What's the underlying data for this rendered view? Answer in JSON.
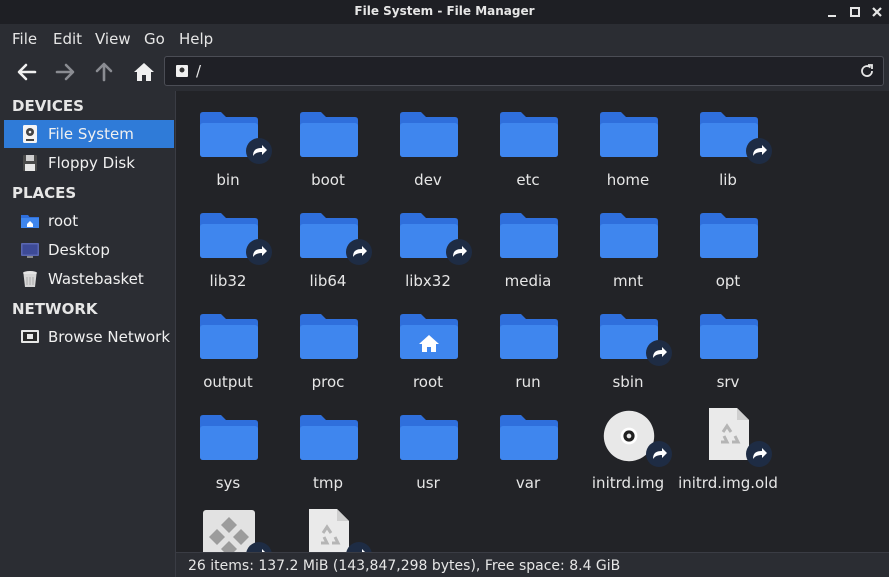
{
  "window": {
    "title": "File System - File Manager"
  },
  "menu": [
    "File",
    "Edit",
    "View",
    "Go",
    "Help"
  ],
  "location": {
    "path": "/"
  },
  "sidebar": {
    "devices_label": "DEVICES",
    "devices": [
      {
        "label": "File System",
        "icon": "drive-icon",
        "active": true
      },
      {
        "label": "Floppy Disk",
        "icon": "floppy-icon",
        "active": false
      }
    ],
    "places_label": "PLACES",
    "places": [
      {
        "label": "root",
        "icon": "home-folder-icon"
      },
      {
        "label": "Desktop",
        "icon": "desktop-icon"
      },
      {
        "label": "Wastebasket",
        "icon": "trash-icon"
      }
    ],
    "network_label": "NETWORK",
    "network": [
      {
        "label": "Browse Network",
        "icon": "network-icon"
      }
    ]
  },
  "files": [
    {
      "name": "bin",
      "type": "folder",
      "link": true
    },
    {
      "name": "boot",
      "type": "folder",
      "link": false
    },
    {
      "name": "dev",
      "type": "folder",
      "link": false
    },
    {
      "name": "etc",
      "type": "folder",
      "link": false
    },
    {
      "name": "home",
      "type": "folder",
      "link": false
    },
    {
      "name": "lib",
      "type": "folder",
      "link": true
    },
    {
      "name": "lib32",
      "type": "folder",
      "link": true
    },
    {
      "name": "lib64",
      "type": "folder",
      "link": true
    },
    {
      "name": "libx32",
      "type": "folder",
      "link": true
    },
    {
      "name": "media",
      "type": "folder",
      "link": false
    },
    {
      "name": "mnt",
      "type": "folder",
      "link": false
    },
    {
      "name": "opt",
      "type": "folder",
      "link": false
    },
    {
      "name": "output",
      "type": "folder",
      "link": false
    },
    {
      "name": "proc",
      "type": "folder",
      "link": false
    },
    {
      "name": "root",
      "type": "home-folder",
      "link": false
    },
    {
      "name": "run",
      "type": "folder",
      "link": false
    },
    {
      "name": "sbin",
      "type": "folder",
      "link": true
    },
    {
      "name": "srv",
      "type": "folder",
      "link": false
    },
    {
      "name": "sys",
      "type": "folder",
      "link": false
    },
    {
      "name": "tmp",
      "type": "folder",
      "link": false
    },
    {
      "name": "usr",
      "type": "folder",
      "link": false
    },
    {
      "name": "var",
      "type": "folder",
      "link": false
    },
    {
      "name": "initrd.img",
      "type": "disc",
      "link": true
    },
    {
      "name": "initrd.img.old",
      "type": "recycle-file",
      "link": true
    },
    {
      "name": "",
      "type": "binary",
      "link": true
    },
    {
      "name": "",
      "type": "recycle-file",
      "link": true
    }
  ],
  "status": {
    "text": "26 items: 137.2 MiB (143,847,298 bytes), Free space: 8.4 GiB"
  },
  "colors": {
    "folder": "#2f6fdc",
    "folder_top": "#3f86ee",
    "selection": "#2f7bd8",
    "badge": "#1e2c44"
  }
}
